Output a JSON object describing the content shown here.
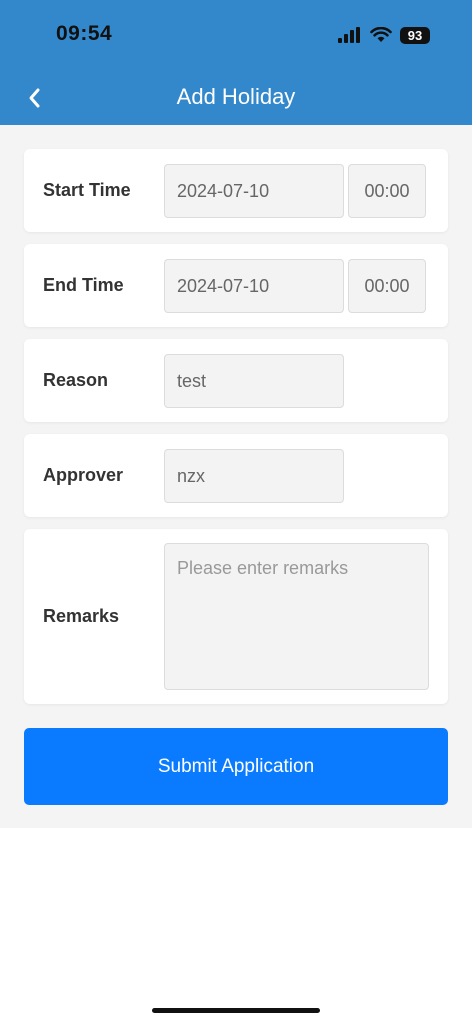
{
  "status_bar": {
    "time": "09:54",
    "battery": "93",
    "icons": [
      "cellular-signal-icon",
      "wifi-icon",
      "battery-icon"
    ]
  },
  "nav": {
    "title": "Add Holiday",
    "back_icon": "chevron-left-icon"
  },
  "form": {
    "start_time": {
      "label": "Start Time",
      "date": "2024-07-10",
      "time": "00:00"
    },
    "end_time": {
      "label": "End Time",
      "date": "2024-07-10",
      "time": "00:00"
    },
    "reason": {
      "label": "Reason",
      "value": "test"
    },
    "approver": {
      "label": "Approver",
      "value": "nzx"
    },
    "remarks": {
      "label": "Remarks",
      "value": "",
      "placeholder": "Please enter remarks"
    }
  },
  "submit_label": "Submit Application",
  "colors": {
    "header": "#3388cb",
    "page_background": "#f4f4f4",
    "primary_button": "#0a7bff"
  }
}
